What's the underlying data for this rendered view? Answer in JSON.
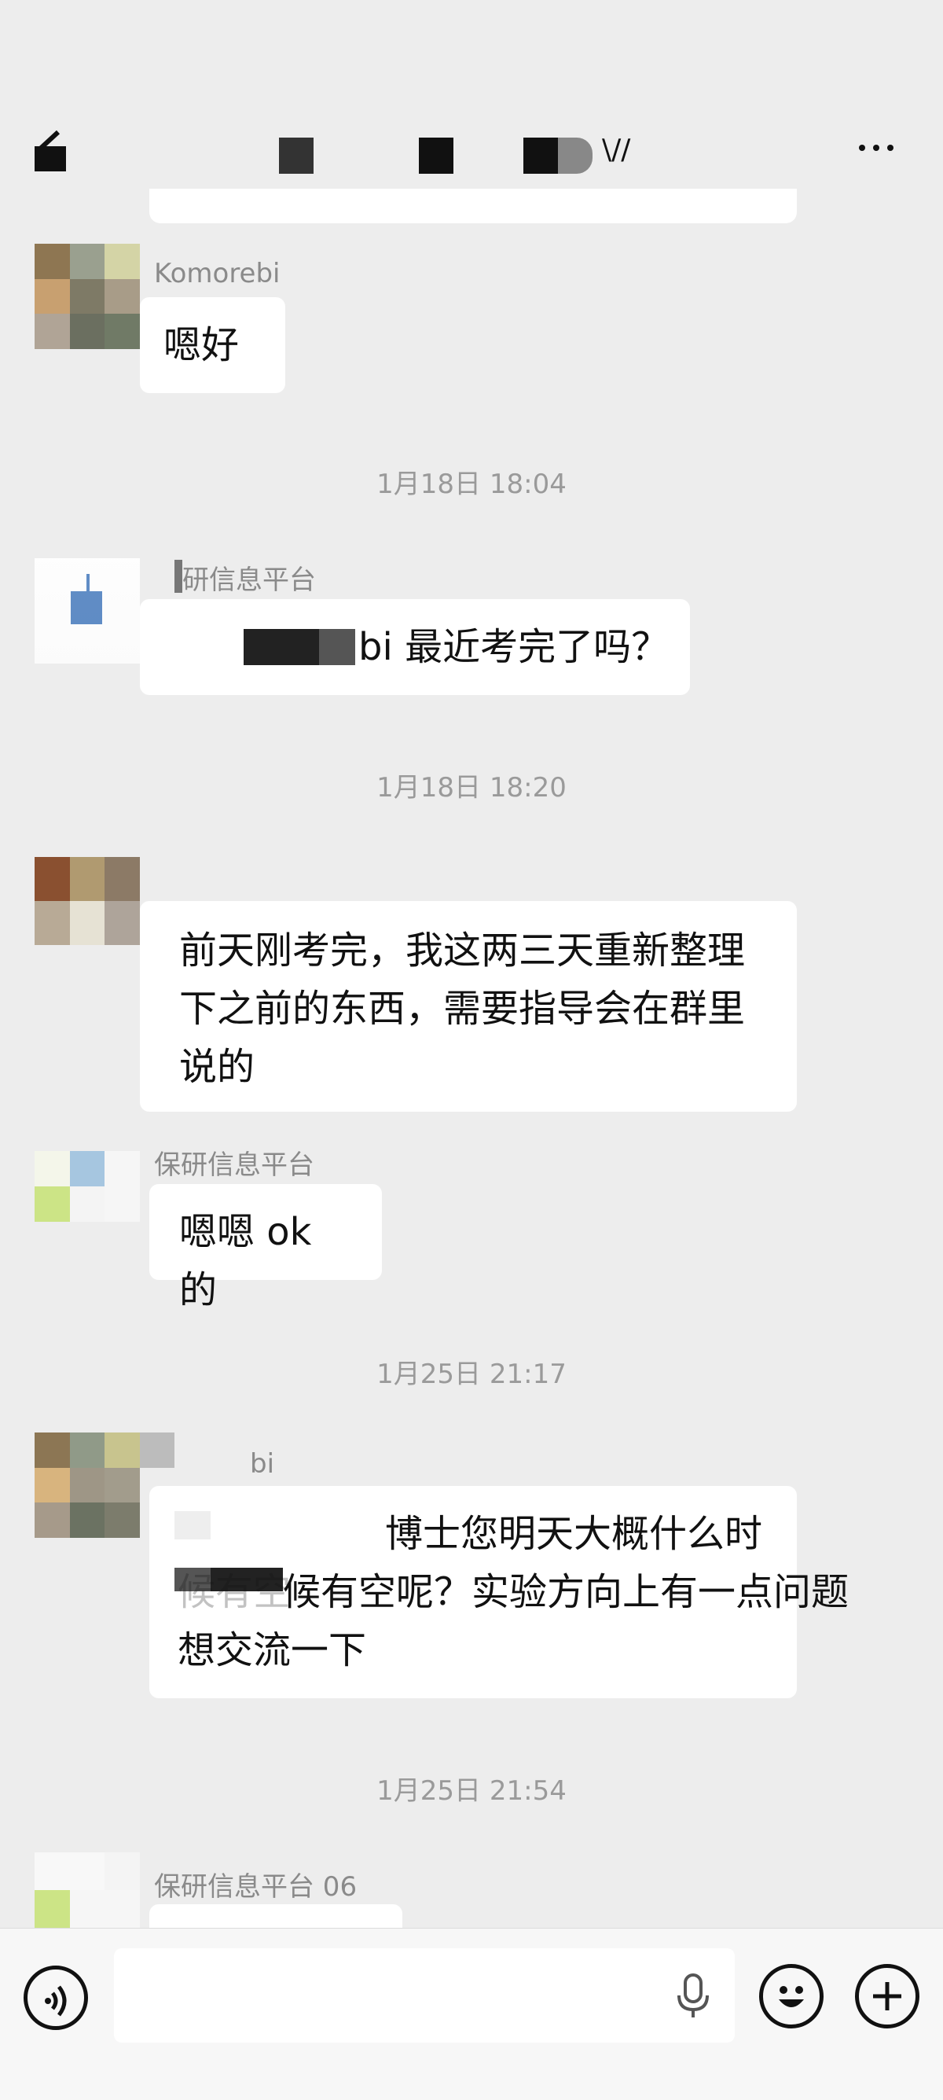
{
  "header": {
    "title_fragment": "\\//",
    "more_label": "More"
  },
  "messages": [
    {
      "sender": "Komorebi",
      "text": "嗯好"
    },
    {
      "time": "1月18日 18:04"
    },
    {
      "sender": "研信息平台",
      "text": "bi 最近考完了吗？"
    },
    {
      "time": "1月18日 18:20"
    },
    {
      "sender": "",
      "lines": [
        "前天刚考完，我这两三天重新整理",
        "下之前的东西，需要指导会在群里",
        "说的"
      ]
    },
    {
      "sender": "保研信息平台",
      "text": "嗯嗯 ok 的"
    },
    {
      "time": "1月25日 21:17"
    },
    {
      "sender": "bi",
      "lines": [
        "博士您明天大概什么时",
        "候有空呢？实验方向上有一点问题",
        "想交流一下"
      ]
    },
    {
      "time": "1月25日 21:54"
    },
    {
      "sender": "保研信息平台 06",
      "text": ""
    }
  ],
  "icons": {
    "back": "back-icon",
    "more": "more-icon",
    "voice": "voice-icon",
    "mic": "mic-icon",
    "emoji": "emoji-icon",
    "plus": "plus-icon"
  },
  "composer": {
    "placeholder": ""
  }
}
